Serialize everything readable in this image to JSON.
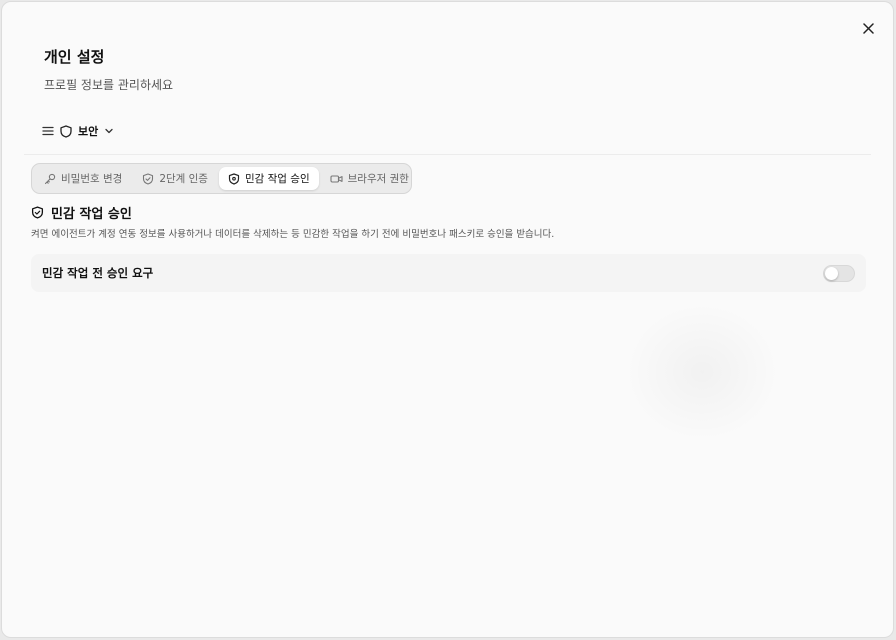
{
  "header": {
    "title": "개인 설정",
    "subtitle": "프로필 정보를 관리하세요"
  },
  "section_select": {
    "label": "보안"
  },
  "tabs": [
    {
      "label": "비밀번호 변경",
      "icon": "key-icon",
      "active": false
    },
    {
      "label": "2단계 인증",
      "icon": "shield-check-icon",
      "active": false
    },
    {
      "label": "민감 작업 승인",
      "icon": "shield-icon",
      "active": true
    },
    {
      "label": "브라우저 권한",
      "icon": "video-icon",
      "active": false
    }
  ],
  "panel": {
    "title": "민감 작업 승인",
    "description": "켜면 에이전트가 계정 연동 정보를 사용하거나 데이터를 삭제하는 등 민감한 작업을 하기 전에 비밀번호나 패스키로 승인을 받습니다.",
    "setting": {
      "label": "민감 작업 전 승인 요구",
      "enabled": false
    }
  }
}
